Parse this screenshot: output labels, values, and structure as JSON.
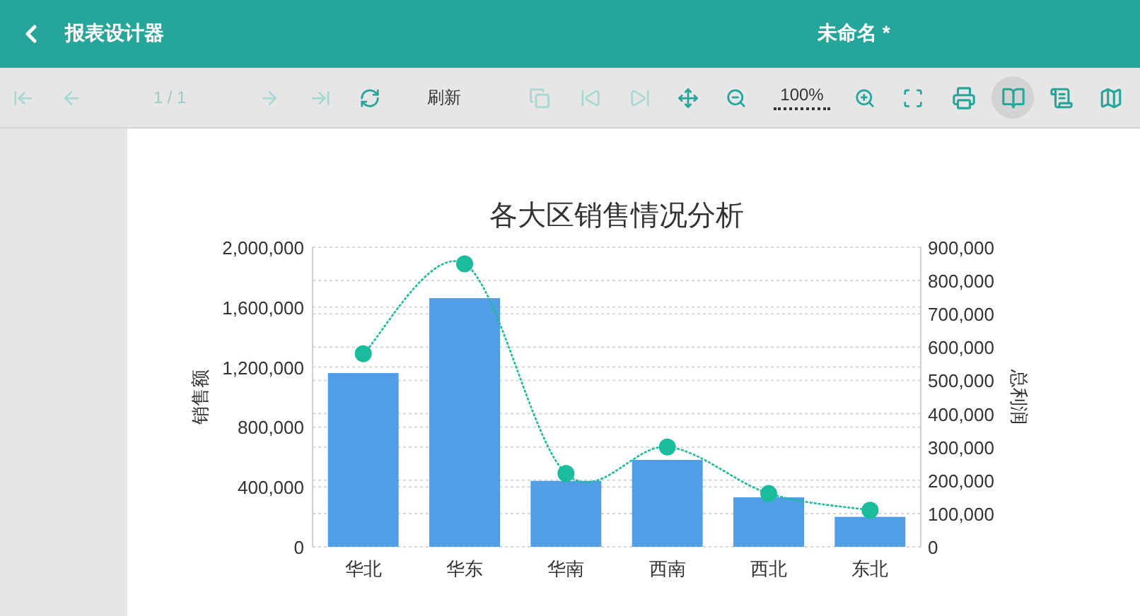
{
  "header": {
    "back_label": "报表设计器",
    "title": "未命名 *"
  },
  "toolbar": [
    {
      "kind": "button",
      "disabled": true,
      "selected": false
    },
    {
      "kind": "button",
      "disabled": true,
      "selected": false
    },
    {
      "kind": "page",
      "text": "1 / 1",
      "disabled": true
    },
    {
      "kind": "button",
      "disabled": true,
      "selected": false
    },
    {
      "kind": "button",
      "disabled": true,
      "selected": false
    },
    {
      "kind": "button",
      "disabled": false,
      "selected": false
    },
    {
      "kind": "label",
      "text": "刷新"
    },
    {
      "kind": "button",
      "disabled": true,
      "selected": false
    },
    {
      "kind": "button",
      "disabled": true,
      "selected": false
    },
    {
      "kind": "button",
      "disabled": true,
      "selected": false
    },
    {
      "kind": "button",
      "disabled": false,
      "selected": false
    },
    {
      "kind": "button",
      "disabled": false,
      "selected": false
    },
    {
      "kind": "zoom",
      "text": "100%"
    },
    {
      "kind": "button",
      "disabled": false,
      "selected": false
    },
    {
      "kind": "button",
      "disabled": false,
      "selected": false
    },
    {
      "kind": "button",
      "disabled": false,
      "selected": false
    },
    {
      "kind": "button",
      "disabled": false,
      "selected": true
    },
    {
      "kind": "button",
      "disabled": false,
      "selected": false
    },
    {
      "kind": "button",
      "disabled": false,
      "selected": false
    }
  ],
  "chart_data": {
    "type": "bar",
    "title": "各大区销售情况分析",
    "ylabel": "销售额",
    "y2label": "总利润",
    "categories": [
      "华北",
      "华东",
      "华南",
      "西南",
      "西北",
      "东北"
    ],
    "grid": true,
    "ylim": [
      0,
      2000000
    ],
    "y2lim": [
      0,
      900000
    ],
    "yticks": [
      {
        "value": 0,
        "label": "0"
      },
      {
        "value": 400000,
        "label": "400,000"
      },
      {
        "value": 800000,
        "label": "800,000"
      },
      {
        "value": 1200000,
        "label": "1,200,000"
      },
      {
        "value": 1600000,
        "label": "1,600,000"
      },
      {
        "value": 2000000,
        "label": "2,000,000"
      }
    ],
    "y2ticks": [
      {
        "value": 0,
        "label": "0"
      },
      {
        "value": 100000,
        "label": "100,000"
      },
      {
        "value": 200000,
        "label": "200,000"
      },
      {
        "value": 300000,
        "label": "300,000"
      },
      {
        "value": 400000,
        "label": "400,000"
      },
      {
        "value": 500000,
        "label": "500,000"
      },
      {
        "value": 600000,
        "label": "600,000"
      },
      {
        "value": 700000,
        "label": "700,000"
      },
      {
        "value": 800000,
        "label": "800,000"
      },
      {
        "value": 900000,
        "label": "900,000"
      }
    ],
    "series": [
      {
        "color": "#519ee6",
        "values": [
          1160000,
          1660000,
          440000,
          580000,
          330000,
          200000
        ]
      },
      {
        "type": "line",
        "axis": "y2",
        "line_style": "dotted",
        "marker": "circle",
        "color": "#1abc9c",
        "values": [
          580000,
          850000,
          220000,
          300000,
          160000,
          110000
        ]
      }
    ]
  }
}
